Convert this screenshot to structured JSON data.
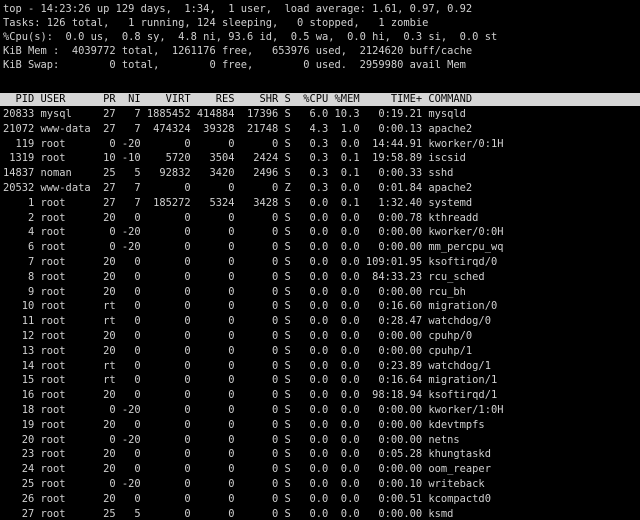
{
  "summary": {
    "top_line": "top - 14:23:26 up 129 days,  1:34,  1 user,  load average: 1.61, 0.97, 0.92",
    "tasks_line": "Tasks: 126 total,   1 running, 124 sleeping,   0 stopped,   1 zombie",
    "cpu_line": "%Cpu(s):  0.0 us,  0.8 sy,  4.8 ni, 93.6 id,  0.5 wa,  0.0 hi,  0.3 si,  0.0 st",
    "mem_line": "KiB Mem :  4039772 total,  1261176 free,   653976 used,  2124620 buff/cache",
    "swap_line": "KiB Swap:        0 total,        0 free,        0 used.  2959980 avail Mem"
  },
  "table": {
    "header": "  PID USER      PR  NI    VIRT    RES    SHR S  %CPU %MEM     TIME+ COMMAND",
    "rows": [
      "20833 mysql     27   7 1885452 414884  17396 S   6.0 10.3   0:19.21 mysqld",
      "21072 www-data  27   7  474324  39328  21748 S   4.3  1.0   0:00.13 apache2",
      "  119 root       0 -20       0      0      0 S   0.3  0.0  14:44.91 kworker/0:1H",
      " 1319 root      10 -10    5720   3504   2424 S   0.3  0.1  19:58.89 iscsid",
      "14837 noman     25   5   92832   3420   2496 S   0.3  0.1   0:00.33 sshd",
      "20532 www-data  27   7       0      0      0 Z   0.3  0.0   0:01.84 apache2",
      "    1 root      27   7  185272   5324   3428 S   0.0  0.1   1:32.40 systemd",
      "    2 root      20   0       0      0      0 S   0.0  0.0   0:00.78 kthreadd",
      "    4 root       0 -20       0      0      0 S   0.0  0.0   0:00.00 kworker/0:0H",
      "    6 root       0 -20       0      0      0 S   0.0  0.0   0:00.00 mm_percpu_wq",
      "    7 root      20   0       0      0      0 S   0.0  0.0 109:01.95 ksoftirqd/0",
      "    8 root      20   0       0      0      0 S   0.0  0.0  84:33.23 rcu_sched",
      "    9 root      20   0       0      0      0 S   0.0  0.0   0:00.00 rcu_bh",
      "   10 root      rt   0       0      0      0 S   0.0  0.0   0:16.60 migration/0",
      "   11 root      rt   0       0      0      0 S   0.0  0.0   0:28.47 watchdog/0",
      "   12 root      20   0       0      0      0 S   0.0  0.0   0:00.00 cpuhp/0",
      "   13 root      20   0       0      0      0 S   0.0  0.0   0:00.00 cpuhp/1",
      "   14 root      rt   0       0      0      0 S   0.0  0.0   0:23.89 watchdog/1",
      "   15 root      rt   0       0      0      0 S   0.0  0.0   0:16.64 migration/1",
      "   16 root      20   0       0      0      0 S   0.0  0.0  98:18.94 ksoftirqd/1",
      "   18 root       0 -20       0      0      0 S   0.0  0.0   0:00.00 kworker/1:0H",
      "   19 root      20   0       0      0      0 S   0.0  0.0   0:00.00 kdevtmpfs",
      "   20 root       0 -20       0      0      0 S   0.0  0.0   0:00.00 netns",
      "   23 root      20   0       0      0      0 S   0.0  0.0   0:05.28 khungtaskd",
      "   24 root      20   0       0      0      0 S   0.0  0.0   0:00.00 oom_reaper",
      "   25 root       0 -20       0      0      0 S   0.0  0.0   0:00.10 writeback",
      "   26 root      20   0       0      0      0 S   0.0  0.0   0:00.51 kcompactd0",
      "   27 root      25   5       0      0      0 S   0.0  0.0   0:00.00 ksmd"
    ]
  }
}
